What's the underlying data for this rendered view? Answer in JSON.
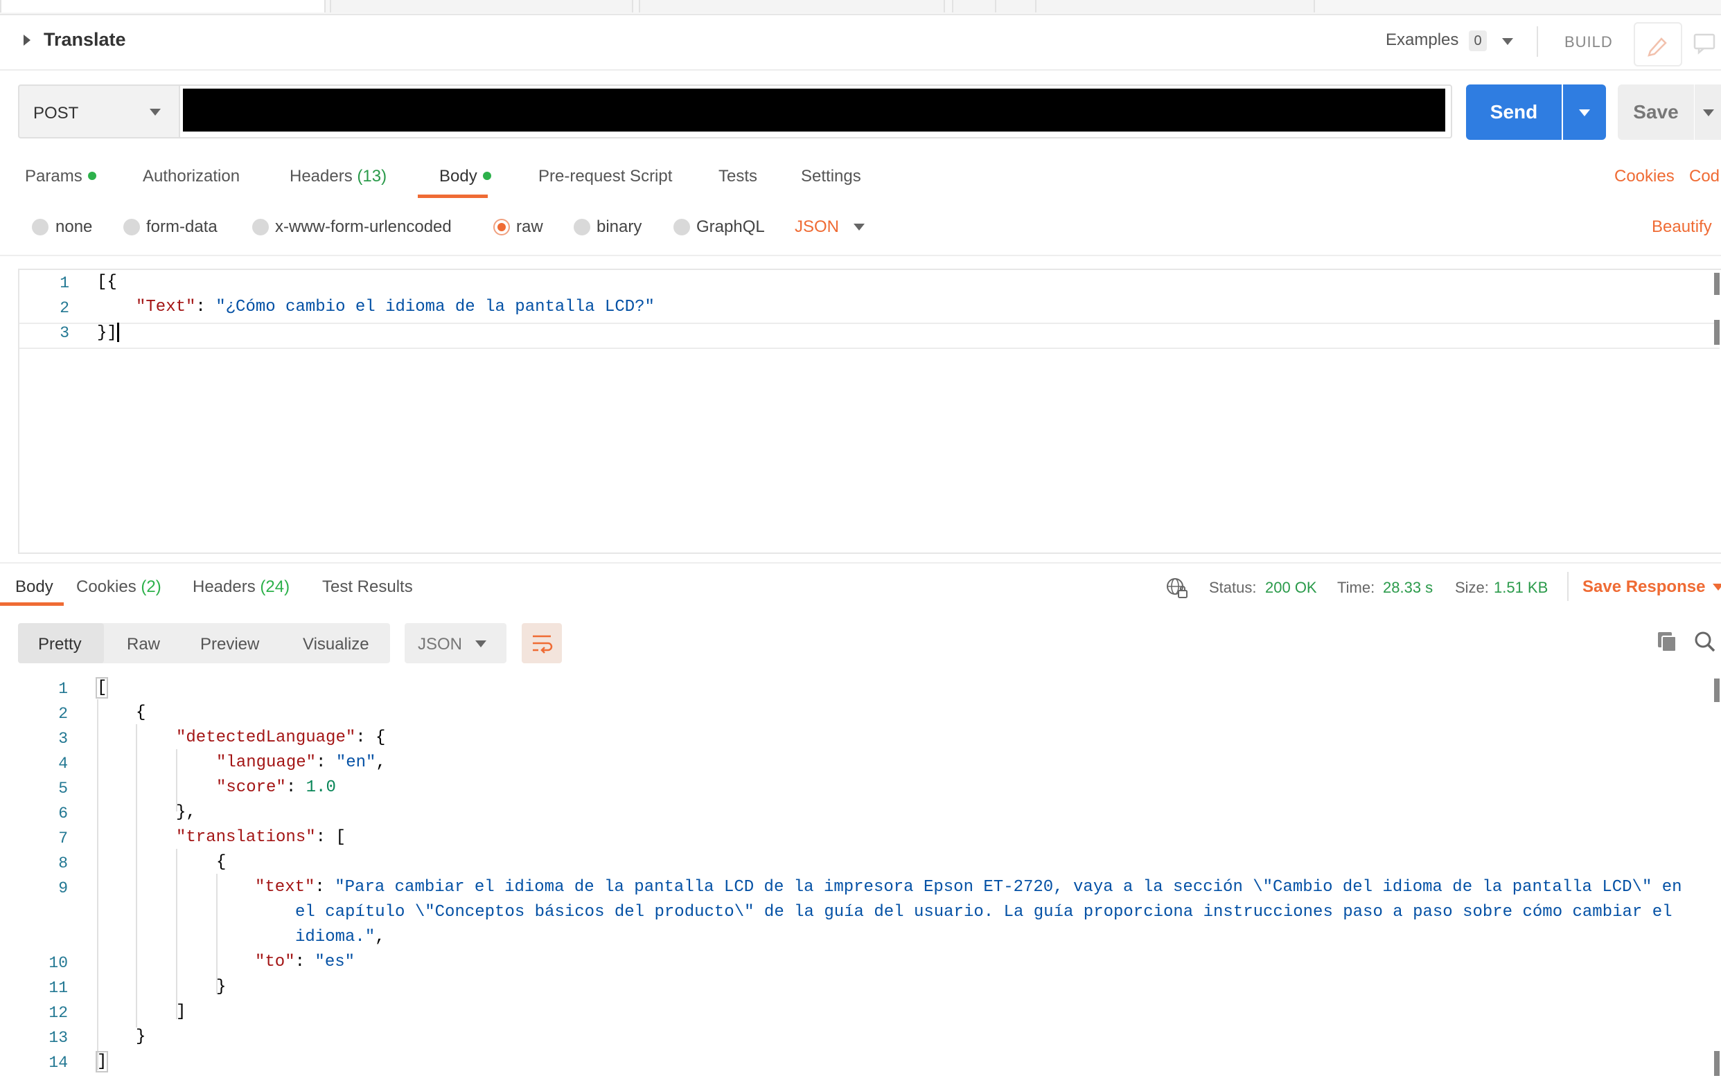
{
  "request": {
    "title": "Translate",
    "examples_label": "Examples",
    "examples_count": "0",
    "build_label": "BUILD",
    "method": "POST",
    "url_value": "",
    "send_label": "Send",
    "save_label": "Save"
  },
  "request_tabs": {
    "params": "Params",
    "authorization": "Authorization",
    "headers": "Headers",
    "headers_count": "(13)",
    "body": "Body",
    "pre_request": "Pre-request Script",
    "tests": "Tests",
    "settings": "Settings",
    "cookies": "Cookies",
    "code": "Cod"
  },
  "body_types": {
    "none": "none",
    "form_data": "form-data",
    "urlencoded": "x-www-form-urlencoded",
    "raw": "raw",
    "binary": "binary",
    "graphql": "GraphQL",
    "format": "JSON",
    "beautify": "Beautify"
  },
  "request_body": {
    "line_numbers": [
      "1",
      "2",
      "3"
    ],
    "line1": "[{",
    "key_text": "\"Text\"",
    "colon": ": ",
    "value_text": "\"¿Cómo cambio el idioma de la pantalla LCD?\"",
    "line3": "}]"
  },
  "response_tabs": {
    "body": "Body",
    "cookies": "Cookies",
    "cookies_count": "(2)",
    "headers": "Headers",
    "headers_count": "(24)",
    "test_results": "Test Results"
  },
  "response_status": {
    "status_label": "Status:",
    "status_value": "200 OK",
    "time_label": "Time:",
    "time_value": "28.33 s",
    "size_label": "Size:",
    "size_value": "1.51 KB",
    "save_response": "Save Response"
  },
  "response_view": {
    "pretty": "Pretty",
    "raw": "Raw",
    "preview": "Preview",
    "visualize": "Visualize",
    "format": "JSON"
  },
  "response_body": {
    "line_numbers": [
      "1",
      "2",
      "3",
      "4",
      "5",
      "6",
      "7",
      "8",
      "9",
      "10",
      "11",
      "12",
      "13",
      "14"
    ],
    "l1": "[",
    "l2": "{",
    "detected_key": "\"detectedLanguage\"",
    "language_key": "\"language\"",
    "language_val": "\"en\"",
    "score_key": "\"score\"",
    "score_val": "1.0",
    "l6": "},",
    "translations_key": "\"translations\"",
    "l8": "{",
    "text_key": "\"text\"",
    "text_val_1": "\"Para cambiar el idioma de la pantalla LCD de la impresora Epson ET-2720, vaya a la sección \\\"Cambio del idioma de la pantalla LCD\\\" en",
    "text_val_2": "el capítulo \\\"Conceptos básicos del producto\\\" de la guía del usuario. La guía proporciona instrucciones paso a paso sobre cómo cambiar el",
    "text_val_3": "idioma.\"",
    "to_key": "\"to\"",
    "to_val": "\"es\"",
    "l11": "}",
    "l12": "]",
    "l13": "}",
    "l14": "]"
  },
  "colors": {
    "accent_orange": "#ef6b34",
    "send_blue": "#2f7de1",
    "status_green": "#2a9a4a"
  }
}
